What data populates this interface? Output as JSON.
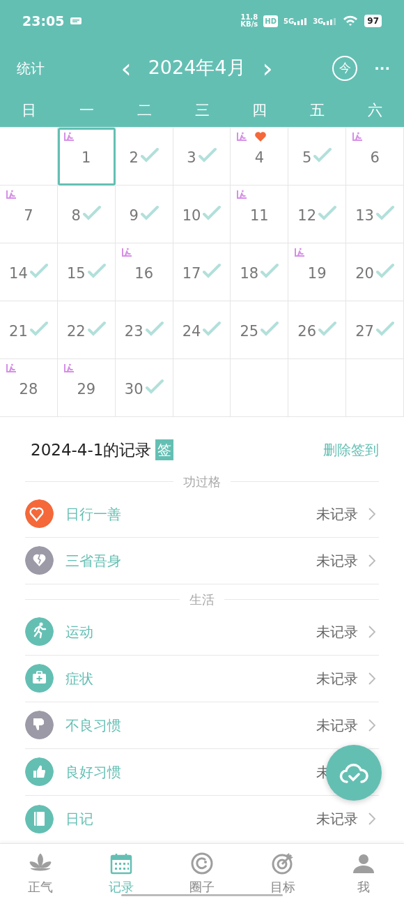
{
  "status_bar": {
    "time": "23:05",
    "speed": "11.8",
    "speed_unit": "KB/s",
    "hd": "HD",
    "sim1": "5G",
    "sim2": "3G",
    "battery": "97"
  },
  "header": {
    "stats": "统计",
    "prev": "‹",
    "title": "2024年4月",
    "next": "›",
    "today": "今",
    "more": "···"
  },
  "weekdays": [
    "日",
    "一",
    "二",
    "三",
    "四",
    "五",
    "六"
  ],
  "calendar": {
    "days": [
      {
        "day": "1",
        "checked": false,
        "marked": true,
        "heart": false,
        "selected": true
      },
      {
        "day": "2",
        "checked": true,
        "marked": false,
        "heart": false,
        "selected": false
      },
      {
        "day": "3",
        "checked": true,
        "marked": false,
        "heart": false,
        "selected": false
      },
      {
        "day": "4",
        "checked": false,
        "marked": true,
        "heart": true,
        "selected": false
      },
      {
        "day": "5",
        "checked": true,
        "marked": false,
        "heart": false,
        "selected": false
      },
      {
        "day": "6",
        "checked": false,
        "marked": true,
        "heart": false,
        "selected": false
      },
      {
        "day": "7",
        "checked": false,
        "marked": true,
        "heart": false,
        "selected": false
      },
      {
        "day": "8",
        "checked": true,
        "marked": false,
        "heart": false,
        "selected": false
      },
      {
        "day": "9",
        "checked": true,
        "marked": false,
        "heart": false,
        "selected": false
      },
      {
        "day": "10",
        "checked": true,
        "marked": false,
        "heart": false,
        "selected": false
      },
      {
        "day": "11",
        "checked": false,
        "marked": true,
        "heart": false,
        "selected": false
      },
      {
        "day": "12",
        "checked": true,
        "marked": false,
        "heart": false,
        "selected": false
      },
      {
        "day": "13",
        "checked": true,
        "marked": false,
        "heart": false,
        "selected": false
      },
      {
        "day": "14",
        "checked": true,
        "marked": false,
        "heart": false,
        "selected": false
      },
      {
        "day": "15",
        "checked": true,
        "marked": false,
        "heart": false,
        "selected": false
      },
      {
        "day": "16",
        "checked": false,
        "marked": true,
        "heart": false,
        "selected": false
      },
      {
        "day": "17",
        "checked": true,
        "marked": false,
        "heart": false,
        "selected": false
      },
      {
        "day": "18",
        "checked": true,
        "marked": false,
        "heart": false,
        "selected": false
      },
      {
        "day": "19",
        "checked": false,
        "marked": true,
        "heart": false,
        "selected": false
      },
      {
        "day": "20",
        "checked": true,
        "marked": false,
        "heart": false,
        "selected": false
      },
      {
        "day": "21",
        "checked": true,
        "marked": false,
        "heart": false,
        "selected": false
      },
      {
        "day": "22",
        "checked": true,
        "marked": false,
        "heart": false,
        "selected": false
      },
      {
        "day": "23",
        "checked": true,
        "marked": false,
        "heart": false,
        "selected": false
      },
      {
        "day": "24",
        "checked": true,
        "marked": false,
        "heart": false,
        "selected": false
      },
      {
        "day": "25",
        "checked": true,
        "marked": false,
        "heart": false,
        "selected": false
      },
      {
        "day": "26",
        "checked": true,
        "marked": false,
        "heart": false,
        "selected": false
      },
      {
        "day": "27",
        "checked": true,
        "marked": false,
        "heart": false,
        "selected": false
      },
      {
        "day": "28",
        "checked": false,
        "marked": true,
        "heart": false,
        "selected": false
      },
      {
        "day": "29",
        "checked": false,
        "marked": true,
        "heart": false,
        "selected": false
      },
      {
        "day": "30",
        "checked": true,
        "marked": false,
        "heart": false,
        "selected": false
      }
    ]
  },
  "record": {
    "title": "2024-4-1的记录",
    "sign_badge": "签",
    "delete": "删除签到"
  },
  "sections": [
    {
      "title": "功过格",
      "items": [
        {
          "label": "日行一善",
          "value": "未记录",
          "chevron": true,
          "color": "#f4683a"
        },
        {
          "label": "三省吾身",
          "value": "未记录",
          "chevron": true,
          "color": "#9b9aa6"
        }
      ]
    },
    {
      "title": "生活",
      "items": [
        {
          "label": "运动",
          "value": "未记录",
          "chevron": true,
          "color": "#64bfb3"
        },
        {
          "label": "症状",
          "value": "未记录",
          "chevron": true,
          "color": "#64bfb3"
        },
        {
          "label": "不良习惯",
          "value": "未记录",
          "chevron": true,
          "color": "#9b9aa6"
        },
        {
          "label": "良好习惯",
          "value": "未",
          "chevron": false,
          "color": "#64bfb3"
        },
        {
          "label": "日记",
          "value": "未记录",
          "chevron": true,
          "color": "#64bfb3"
        }
      ]
    }
  ],
  "bottom_nav": [
    {
      "label": "正气",
      "selected": false
    },
    {
      "label": "记录",
      "selected": true
    },
    {
      "label": "圈子",
      "selected": false
    },
    {
      "label": "目标",
      "selected": false
    },
    {
      "label": "我",
      "selected": false
    }
  ]
}
